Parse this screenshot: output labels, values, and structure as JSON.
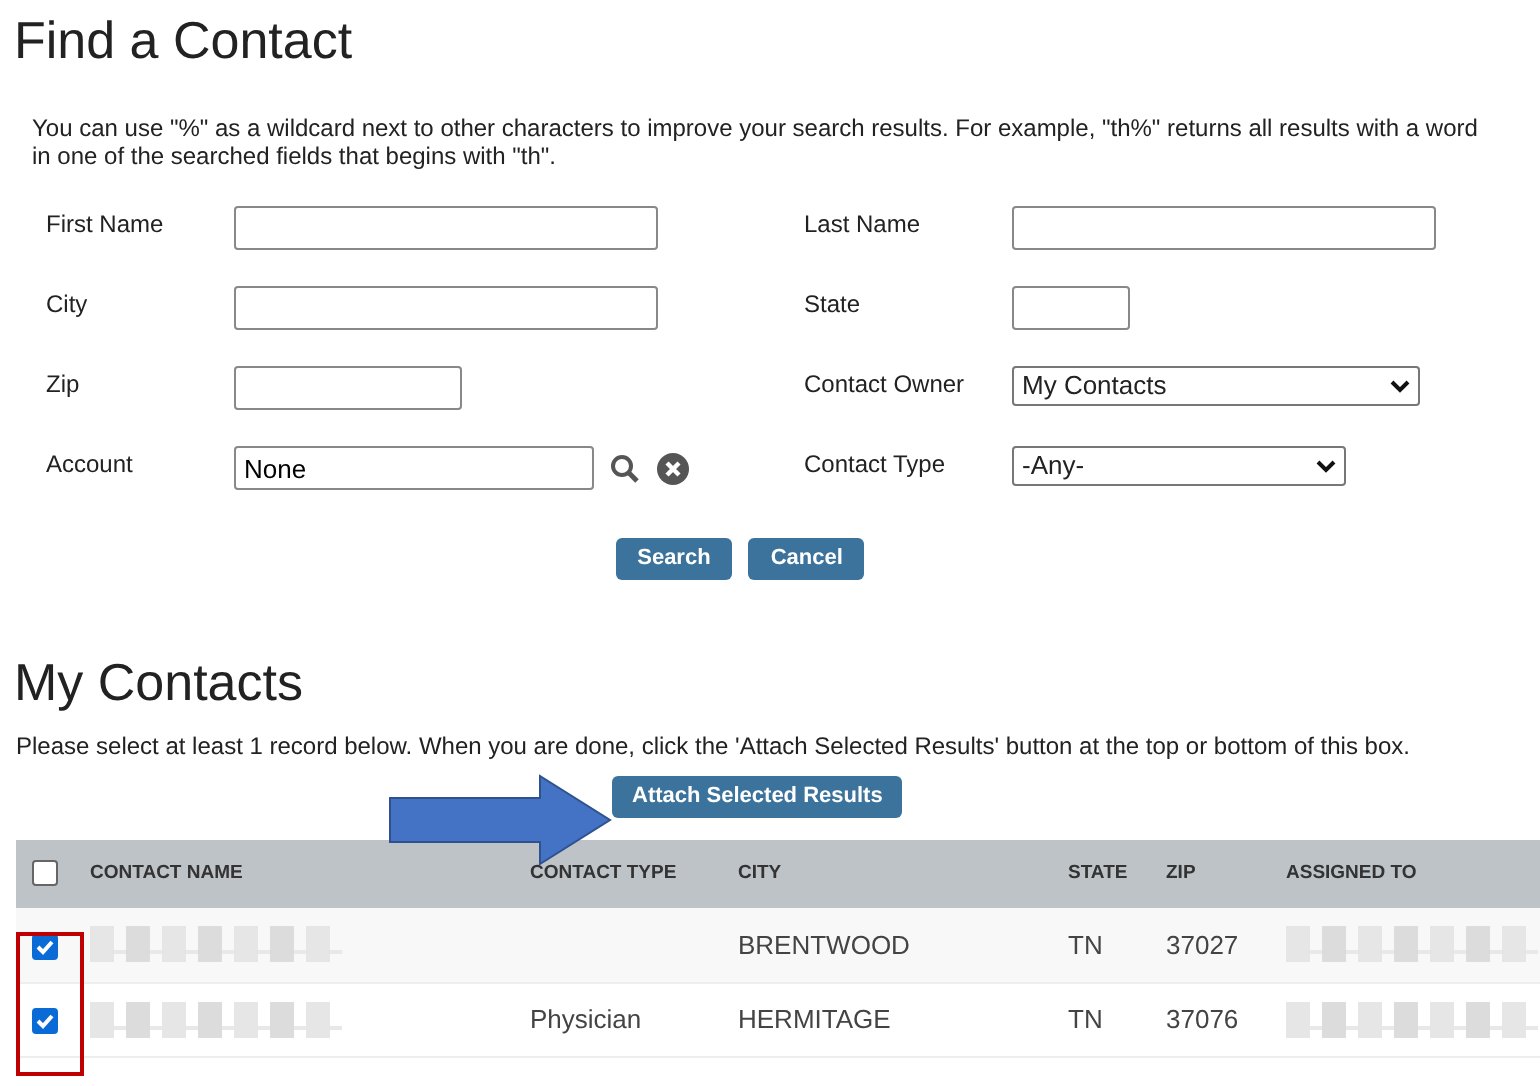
{
  "title": "Find a Contact",
  "hint": "You can use \"%\" as a wildcard next to other characters to improve your search results. For example, \"th%\" returns all results with a word in one of the searched fields that begins with \"th\".",
  "fields": [
    {
      "label": "First Name",
      "kind": "text"
    },
    {
      "label": "Last Name",
      "kind": "text"
    },
    {
      "label": "City",
      "kind": "text"
    },
    {
      "label": "State",
      "kind": "text"
    },
    {
      "label": "Zip",
      "kind": "text"
    },
    {
      "label": "Contact Owner",
      "kind": "select",
      "value": "My Contacts"
    },
    {
      "label": "Account",
      "kind": "lookup",
      "value": "None"
    },
    {
      "label": "Contact Type",
      "kind": "select",
      "value": "-Any-"
    }
  ],
  "buttons": [
    "Search",
    "Cancel"
  ],
  "results": {
    "title": "My Contacts",
    "instruction": "Please select at least 1 record below. When you are done, click the 'Attach Selected Results' button at the top or bottom of this box.",
    "attach_button": "Attach Selected Results",
    "select_all_checked": false,
    "columns": [
      "CONTACT NAME",
      "CONTACT TYPE",
      "CITY",
      "STATE",
      "ZIP",
      "ASSIGNED TO"
    ],
    "rows": [
      {
        "checked": true,
        "contact_name_redacted": true,
        "city": "BRENTWOOD",
        "state": "TN",
        "zip": "37027",
        "assigned_to_redacted": true
      },
      {
        "checked": true,
        "contact_name_redacted": true,
        "contact_type": "Physician",
        "city": "HERMITAGE",
        "state": "TN",
        "zip": "37076",
        "assigned_to_redacted": true
      }
    ]
  },
  "annotations": {
    "arrow": true,
    "highlight_checkboxes": true
  }
}
